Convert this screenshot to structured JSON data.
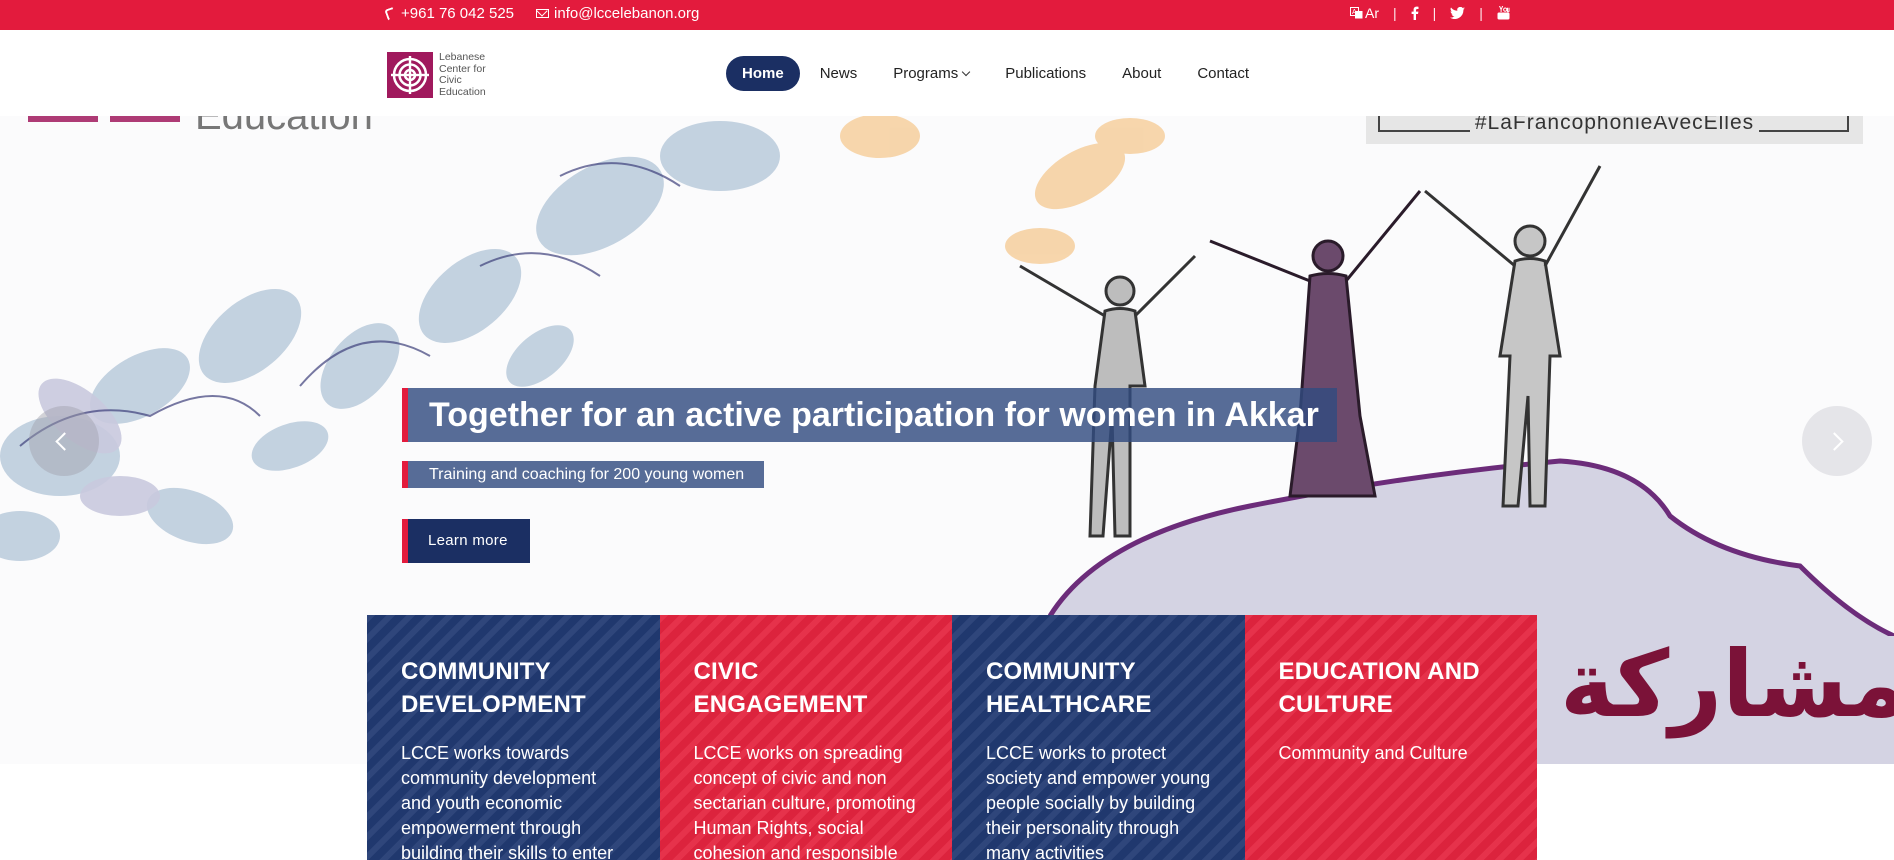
{
  "topbar": {
    "phone": "+961 76 042 525",
    "email": "info@lccelebanon.org",
    "lang": "Ar",
    "separator": "|",
    "social_icons": [
      "translate-icon",
      "facebook-icon",
      "twitter-icon",
      "youtube-icon"
    ],
    "bg_color": "#e31b3d"
  },
  "brand": {
    "logo_lines": [
      "Lebanese",
      "Center for",
      "Civic",
      "Education"
    ],
    "logo_color": "#a0195d"
  },
  "nav": {
    "items": [
      "Home",
      "News",
      "Programs",
      "Publications",
      "About",
      "Contact"
    ],
    "active": "Home",
    "active_color": "#1b2f63"
  },
  "hero": {
    "title": "Together for an active participation for women in Akkar",
    "subtitle": "Training and coaching for 200 young women",
    "cta": "Learn more",
    "hashtag_banner": "#LaFrancophonieAvecElles",
    "arabic_text": "للمشاركة",
    "corner_text": "Education",
    "accent_color": "#e31b3d"
  },
  "cards": [
    {
      "title": "COMMUNITY DEVELOPMENT",
      "text": "LCCE works towards community development and youth economic empowerment through building their skills to enter",
      "color": "#213a72"
    },
    {
      "title": "CIVIC ENGAGEMENT",
      "text": "LCCE works on spreading concept of civic and non sectarian culture, promoting Human Rights, social cohesion and responsible citizenship among Youths.",
      "color": "#e4243f"
    },
    {
      "title": "COMMUNITY HEALTHCARE",
      "text": "LCCE works to protect society and empower young people socially by building their personality through many activities",
      "color": "#213a72"
    },
    {
      "title": "EDUCATION AND CULTURE",
      "text": "Community and Culture",
      "color": "#e4243f"
    }
  ]
}
